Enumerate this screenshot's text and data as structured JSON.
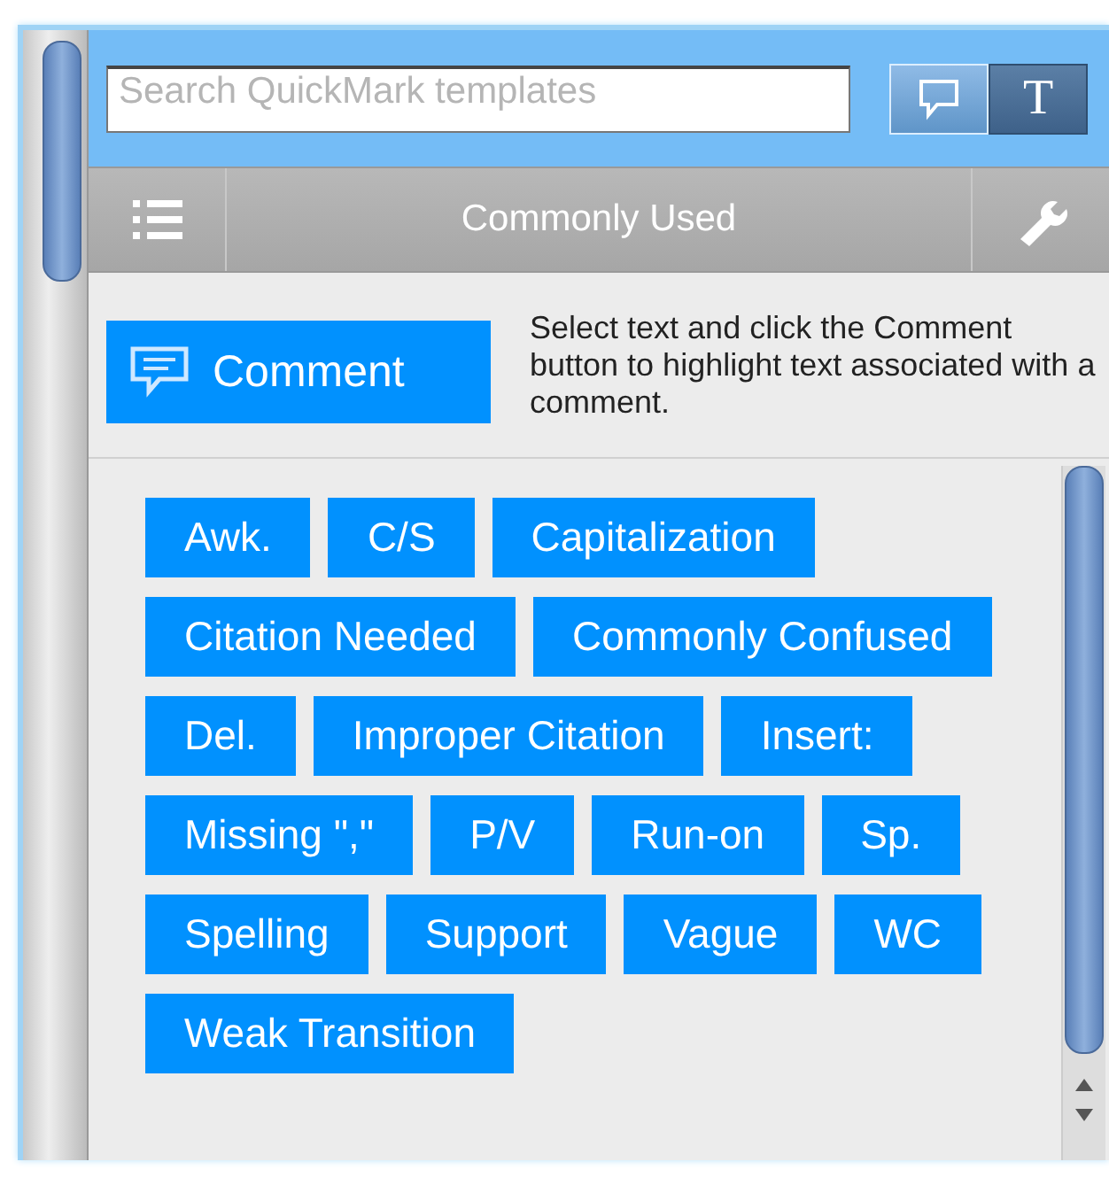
{
  "search": {
    "placeholder": "Search QuickMark templates"
  },
  "mode_buttons": [
    {
      "kind": "comment",
      "selected": false
    },
    {
      "kind": "text",
      "label": "T",
      "selected": true
    }
  ],
  "category_bar": {
    "title": "Commonly Used"
  },
  "comment_button": {
    "label": "Comment"
  },
  "instructions": "Select text and click the Comment button to highlight text associated with a comment.",
  "quickmarks": [
    "Awk.",
    "C/S",
    "Capitalization",
    "Citation Needed",
    "Commonly Confused",
    "Del.",
    "Improper Citation",
    "Insert:",
    "Missing \",\"",
    "P/V",
    "Run-on",
    "Sp.",
    "Spelling",
    "Support",
    "Vague",
    "WC",
    "Weak Transition"
  ]
}
